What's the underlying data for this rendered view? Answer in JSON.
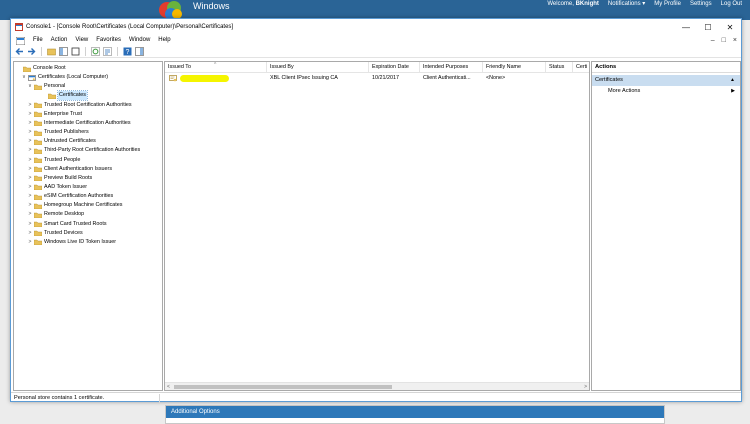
{
  "site": {
    "logo_text": "Windows",
    "links": [
      {
        "text": "Welcome, ",
        "bold": "BKnight"
      },
      {
        "text": "Notifications ▾"
      },
      {
        "text": "My Profile"
      },
      {
        "text": "Settings"
      },
      {
        "text": "Log Out"
      }
    ],
    "additional_options": "Additional Options"
  },
  "window": {
    "title": "Console1 - [Console Root\\Certificates (Local Computer)\\Personal\\Certificates]",
    "controls": {
      "minimize": "—",
      "maximize": "☐",
      "close": "✕"
    }
  },
  "menubar": {
    "items": [
      "File",
      "Action",
      "View",
      "Favorites",
      "Window",
      "Help"
    ],
    "right": {
      "minimize": "–",
      "restore": "□",
      "close": "×"
    }
  },
  "tree": {
    "items": [
      {
        "label": "Console Root",
        "depth": 0,
        "chevron": "",
        "icon": "folder"
      },
      {
        "label": "Certificates (Local Computer)",
        "depth": 1,
        "chevron": "∨",
        "icon": "cert-store"
      },
      {
        "label": "Personal",
        "depth": 2,
        "chevron": "∨",
        "icon": "folder"
      },
      {
        "label": "Certificates",
        "depth": 3,
        "chevron": "",
        "icon": "folder",
        "selected": true
      },
      {
        "label": "Trusted Root Certification Authorities",
        "depth": 2,
        "chevron": ">",
        "icon": "folder"
      },
      {
        "label": "Enterprise Trust",
        "depth": 2,
        "chevron": ">",
        "icon": "folder"
      },
      {
        "label": "Intermediate Certification Authorities",
        "depth": 2,
        "chevron": ">",
        "icon": "folder"
      },
      {
        "label": "Trusted Publishers",
        "depth": 2,
        "chevron": ">",
        "icon": "folder"
      },
      {
        "label": "Untrusted Certificates",
        "depth": 2,
        "chevron": ">",
        "icon": "folder"
      },
      {
        "label": "Third-Party Root Certification Authorities",
        "depth": 2,
        "chevron": ">",
        "icon": "folder"
      },
      {
        "label": "Trusted People",
        "depth": 2,
        "chevron": ">",
        "icon": "folder"
      },
      {
        "label": "Client Authentication Issuers",
        "depth": 2,
        "chevron": ">",
        "icon": "folder"
      },
      {
        "label": "Preview Build Roots",
        "depth": 2,
        "chevron": ">",
        "icon": "folder"
      },
      {
        "label": "AAD Token Issuer",
        "depth": 2,
        "chevron": ">",
        "icon": "folder"
      },
      {
        "label": "eSIM Certification Authorities",
        "depth": 2,
        "chevron": ">",
        "icon": "folder"
      },
      {
        "label": "Homegroup Machine Certificates",
        "depth": 2,
        "chevron": ">",
        "icon": "folder"
      },
      {
        "label": "Remote Desktop",
        "depth": 2,
        "chevron": ">",
        "icon": "folder"
      },
      {
        "label": "Smart Card Trusted Roots",
        "depth": 2,
        "chevron": ">",
        "icon": "folder"
      },
      {
        "label": "Trusted Devices",
        "depth": 2,
        "chevron": ">",
        "icon": "folder"
      },
      {
        "label": "Windows Live ID Token Issuer",
        "depth": 2,
        "chevron": ">",
        "icon": "folder"
      }
    ]
  },
  "list": {
    "columns": [
      "Issued To",
      "Issued By",
      "Expiration Date",
      "Intended Purposes",
      "Friendly Name",
      "Status",
      "Certi"
    ],
    "rows": [
      {
        "issued_to": "",
        "issued_by": "XBL Client IPsec Issuing CA",
        "expiration": "10/21/2017",
        "purposes": "Client Authenticati...",
        "friendly_name": "<None>",
        "status": "",
        "cert": ""
      }
    ]
  },
  "actions": {
    "title": "Actions",
    "section": "Certificates",
    "items": [
      "More Actions"
    ]
  },
  "status": {
    "text": "Personal store contains 1 certificate."
  },
  "colors": {
    "site_blue": "#2a6496",
    "window_border": "#5b9bd5",
    "selection": "#cce8ff",
    "actions_section": "#c9ddf0",
    "folder": "#e8c25a",
    "redaction": "#f5f500"
  }
}
